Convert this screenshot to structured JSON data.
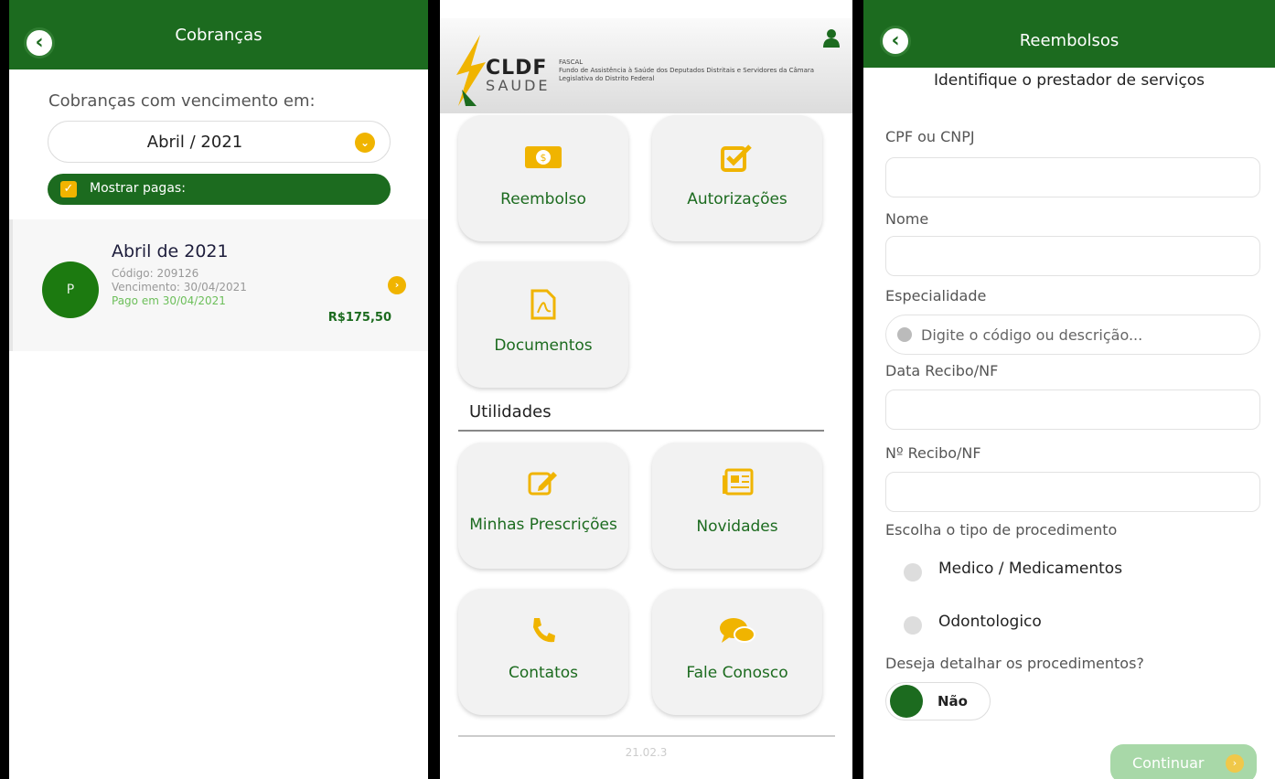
{
  "cobrancas": {
    "title": "Cobranças",
    "back_icon": "chevron-left-icon",
    "due_label": "Cobranças com vencimento em:",
    "month_value": "Abril / 2021",
    "show_paid_label": "Mostrar pagas:",
    "show_paid_checked": true,
    "item": {
      "avatar": "P",
      "title": "Abril de 2021",
      "code": "Código: 209126",
      "due": "Vencimento: 30/04/2021",
      "paid": "Pago em 30/04/2021",
      "amount": "R$175,50"
    }
  },
  "home": {
    "logo_main": "CLDF",
    "logo_sub": "SAUDE",
    "logo_fascal": "FASCAL",
    "logo_desc": "Fundo de Assistência à Saúde dos Deputados Distritais e Servidores da Câmara Legislativa do Distrito Federal",
    "tiles": [
      {
        "label": "Reembolso",
        "icon": "money-icon"
      },
      {
        "label": "Autorizações",
        "icon": "checkbox-icon"
      },
      {
        "label": "Documentos",
        "icon": "pdf-icon"
      }
    ],
    "section_label": "Utilidades",
    "utilities": [
      {
        "label": "Minhas Prescrições",
        "icon": "edit-icon"
      },
      {
        "label": "Novidades",
        "icon": "newspaper-icon"
      },
      {
        "label": "Contatos",
        "icon": "phone-icon"
      },
      {
        "label": "Fale Conosco",
        "icon": "chat-icon"
      }
    ],
    "version": "21.02.3"
  },
  "reembolsos": {
    "title": "Reembolsos",
    "subtitle": "Identifique o prestador de serviços",
    "fields": {
      "cpf_label": "CPF ou CNPJ",
      "nome_label": "Nome",
      "especialidade_label": "Especialidade",
      "especialidade_placeholder": "Digite o código ou descrição...",
      "data_label": "Data Recibo/NF",
      "numero_label": "Nº Recibo/NF"
    },
    "procedure_label": "Escolha o tipo de procedimento",
    "procedure_options": [
      "Medico / Medicamentos",
      "Odontologico"
    ],
    "detail_label": "Deseja detalhar os procedimentos?",
    "detail_value": "Não",
    "continue_label": "Continuar"
  },
  "colors": {
    "primary_green": "#1c6b1f",
    "accent_yellow": "#f0b400"
  }
}
